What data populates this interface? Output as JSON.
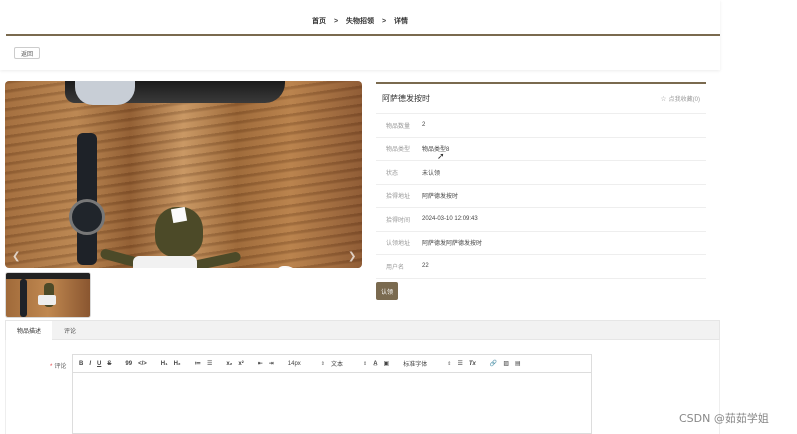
{
  "breadcrumb": {
    "home": "首页",
    "sep": ">",
    "section": "失物招领",
    "current": "详情"
  },
  "back_label": "返回",
  "gallery": {
    "prev_icon": "chevron-left-icon",
    "next_icon": "chevron-right-icon"
  },
  "item": {
    "title": "阿萨德发按时",
    "favorite_label": "点我收藏(0)",
    "fields": [
      {
        "label": "物品数量",
        "value": "2"
      },
      {
        "label": "物品类型",
        "value": "物品类型8"
      },
      {
        "label": "状态",
        "value": "未认领"
      },
      {
        "label": "拾得地址",
        "value": "阿萨德发按时"
      },
      {
        "label": "拾得时间",
        "value": "2024-03-10 12:09:43"
      },
      {
        "label": "认领地址",
        "value": "阿萨德发阿萨德发按时"
      },
      {
        "label": "用户名",
        "value": "22"
      }
    ],
    "claim_label": "认领"
  },
  "tabs": [
    {
      "label": "物品描述",
      "active": true
    },
    {
      "label": "评论",
      "active": false
    }
  ],
  "comment": {
    "label": "评论",
    "required_mark": "*",
    "toolbar": {
      "bold": "B",
      "italic": "I",
      "underline": "U",
      "strike": "S",
      "quote": "99",
      "code": "</>",
      "h1": "H₁",
      "h2": "H₂",
      "ol": "≔",
      "ul": "☰",
      "sub": "x₂",
      "sup": "x²",
      "outdent": "⇤",
      "indent": "⇥",
      "size": "14px",
      "format": "文本",
      "font": "标准字体",
      "clean": "Tx"
    }
  },
  "watermark": "CSDN @茹茹学姐",
  "colors": {
    "accent": "#7a6a4f",
    "required": "#e4393c"
  }
}
